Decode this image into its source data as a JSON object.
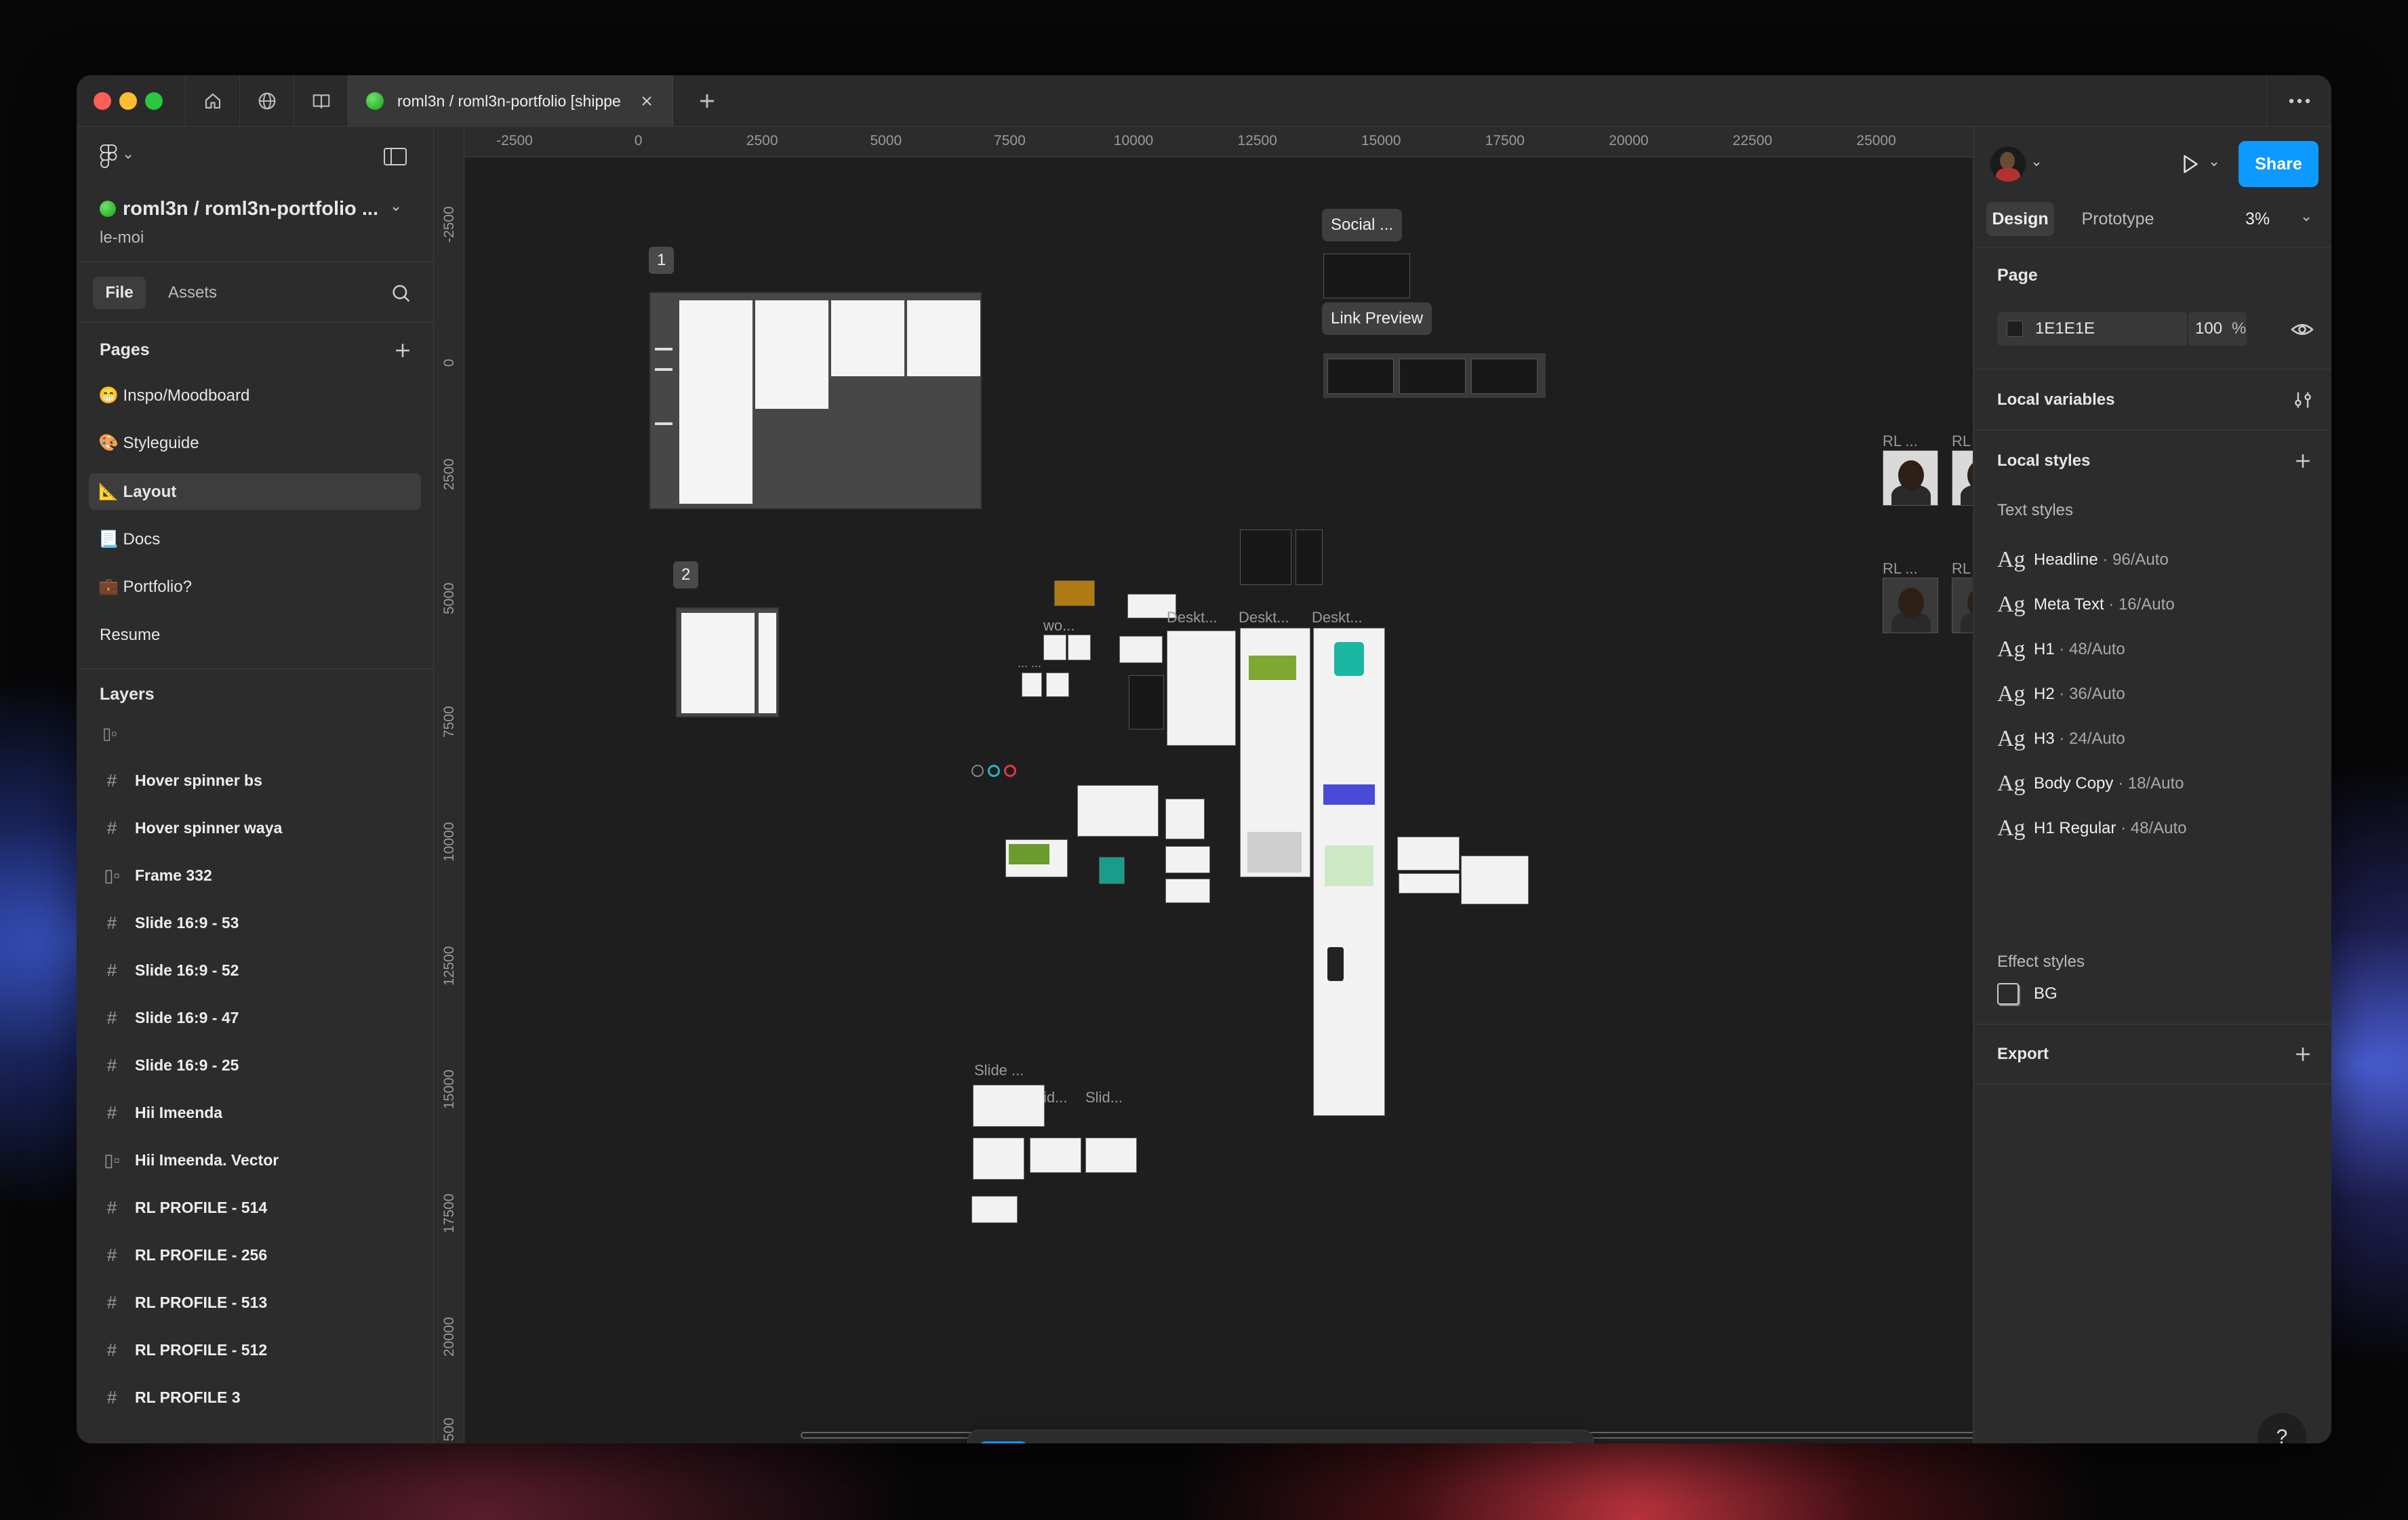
{
  "tab": {
    "title": "roml3n / roml3n-portfolio [shippe"
  },
  "file": {
    "name": "roml3n / roml3n-portfolio ...",
    "team": "le-moi"
  },
  "left_tabs": {
    "file": "File",
    "assets": "Assets"
  },
  "pages": {
    "header": "Pages",
    "items": [
      "😁 Inspo/Moodboard",
      "🎨 Styleguide",
      "📐 Layout",
      "📃 Docs",
      "💼 Portfolio?",
      "Resume"
    ]
  },
  "layers": {
    "header": "Layers",
    "items": [
      {
        "icon": "frame-icon",
        "label": "Hover spinner bs"
      },
      {
        "icon": "frame-icon",
        "label": "Hover spinner waya"
      },
      {
        "icon": "auto-layout-icon",
        "label": "Frame 332"
      },
      {
        "icon": "frame-icon",
        "label": "Slide 16:9 - 53"
      },
      {
        "icon": "frame-icon",
        "label": "Slide 16:9 - 52"
      },
      {
        "icon": "frame-icon",
        "label": "Slide 16:9 - 47"
      },
      {
        "icon": "frame-icon",
        "label": "Slide 16:9 - 25"
      },
      {
        "icon": "frame-icon",
        "label": "Hii Imeenda"
      },
      {
        "icon": "auto-layout-icon",
        "label": "Hii Imeenda. Vector"
      },
      {
        "icon": "frame-icon",
        "label": "RL PROFILE - 514"
      },
      {
        "icon": "frame-icon",
        "label": "RL PROFILE - 256"
      },
      {
        "icon": "frame-icon",
        "label": "RL PROFILE - 513"
      },
      {
        "icon": "frame-icon",
        "label": "RL PROFILE - 512"
      },
      {
        "icon": "frame-icon",
        "label": "RL PROFILE 3"
      }
    ]
  },
  "ruler": {
    "h": [
      "-2500",
      "0",
      "2500",
      "5000",
      "7500",
      "10000",
      "12500",
      "15000",
      "17500",
      "20000",
      "22500",
      "25000"
    ],
    "v": [
      "-2500",
      "0",
      "2500",
      "5000",
      "7500",
      "10000",
      "12500",
      "15000",
      "17500",
      "20000",
      "500"
    ]
  },
  "canvas": {
    "section1": "1",
    "section2": "2",
    "tooltip_social": "Social ...",
    "tooltip_link": "Link Preview",
    "label_wo": "wo...",
    "label_deskt1": "Deskt...",
    "label_deskt2": "Deskt...",
    "label_deskt3": "Deskt...",
    "label_slide1": "Slide ...",
    "label_slide2": "Slid...",
    "label_slide3": "id...",
    "label_rl": "RL ...",
    "dots": "... ..."
  },
  "right": {
    "share": "Share",
    "tabs": {
      "design": "Design",
      "prototype": "Prototype"
    },
    "zoom": "3%",
    "page": {
      "header": "Page",
      "color": "1E1E1E",
      "opacity": "100",
      "unit": "%"
    },
    "local_variables": "Local variables",
    "local_styles": "Local styles",
    "text_styles_header": "Text styles",
    "text_styles": [
      {
        "name": "Headline",
        "size": " · 96/Auto"
      },
      {
        "name": "Meta Text",
        "size": " · 16/Auto"
      },
      {
        "name": "H1",
        "size": " · 48/Auto"
      },
      {
        "name": "H2",
        "size": " · 36/Auto"
      },
      {
        "name": "H3",
        "size": " · 24/Auto"
      },
      {
        "name": "Body Copy",
        "size": " · 18/Auto"
      },
      {
        "name": "H1 Regular",
        "size": " · 48/Auto"
      }
    ],
    "ag": "Ag",
    "effect_styles_header": "Effect styles",
    "effect_styles": [
      "BG"
    ],
    "export": "Export",
    "help": "?"
  },
  "colors": {
    "accent": "#0d99ff",
    "canvas": "#1e1e1e",
    "panel": "#2c2c2c"
  }
}
